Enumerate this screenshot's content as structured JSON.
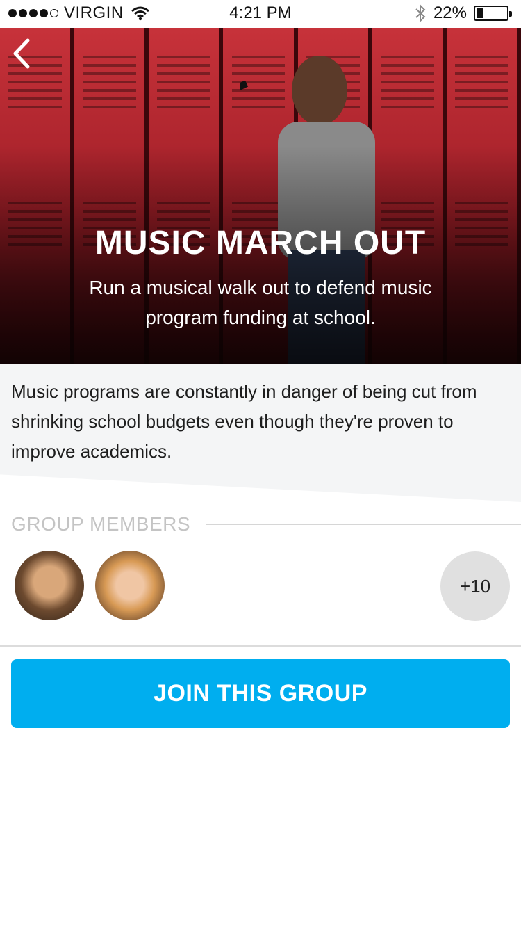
{
  "status_bar": {
    "carrier": "VIRGIN",
    "time": "4:21 PM",
    "battery": "22%",
    "battery_level": 0.22
  },
  "hero": {
    "title": "MUSIC MARCH OUT",
    "subtitle": "Run a musical walk out to defend music program funding at school."
  },
  "description": "Music programs are constantly in danger of being cut from shrinking school budgets even though they're proven to improve academics.",
  "members": {
    "label": "GROUP MEMBERS",
    "more_count": "+10"
  },
  "join_button": "JOIN THIS GROUP",
  "colors": {
    "accent": "#00aeef",
    "lockers": "#a01e27"
  }
}
